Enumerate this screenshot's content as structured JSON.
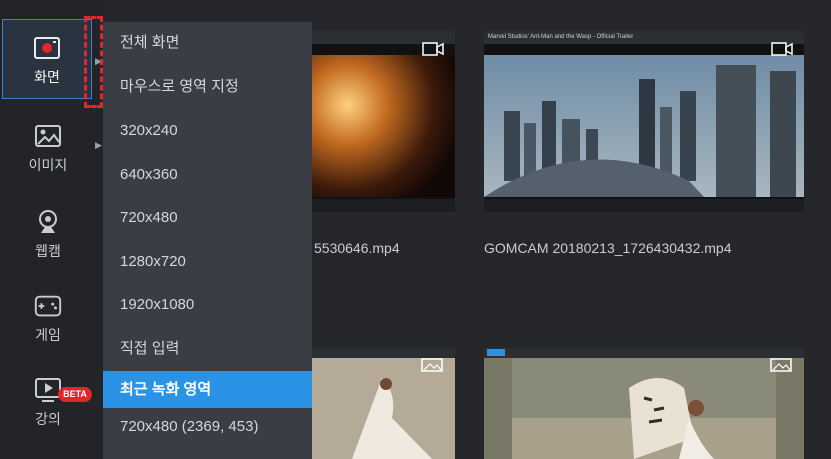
{
  "sidebar": {
    "items": [
      {
        "label": "화면",
        "icon": "screen-record-icon"
      },
      {
        "label": "이미지",
        "icon": "image-icon"
      },
      {
        "label": "웹캠",
        "icon": "webcam-icon"
      },
      {
        "label": "게임",
        "icon": "gamepad-icon"
      },
      {
        "label": "강의",
        "icon": "lecture-icon"
      }
    ],
    "beta_badge": "BETA"
  },
  "menu": {
    "items": [
      "전체 화면",
      "마우스로 영역 지정",
      "320x240",
      "640x360",
      "720x480",
      "1280x720",
      "1920x1080",
      "직접 입력",
      "최근 녹화 영역",
      "720x480 (2369, 453)"
    ],
    "selected": "최근 녹화 영역"
  },
  "files": [
    {
      "name": "5530646.mp4",
      "type": "video"
    },
    {
      "name": "GOMCAM 20180213_1726430432.mp4",
      "type": "video",
      "window_title": "Marvel Studios' Ant-Man and the Wasp - Official Trailer"
    },
    {
      "name": "",
      "type": "image"
    },
    {
      "name": "",
      "type": "image"
    }
  ],
  "colors": {
    "accent": "#2a93e6",
    "highlight_border": "#e2262e",
    "beta": "#e0262b"
  }
}
